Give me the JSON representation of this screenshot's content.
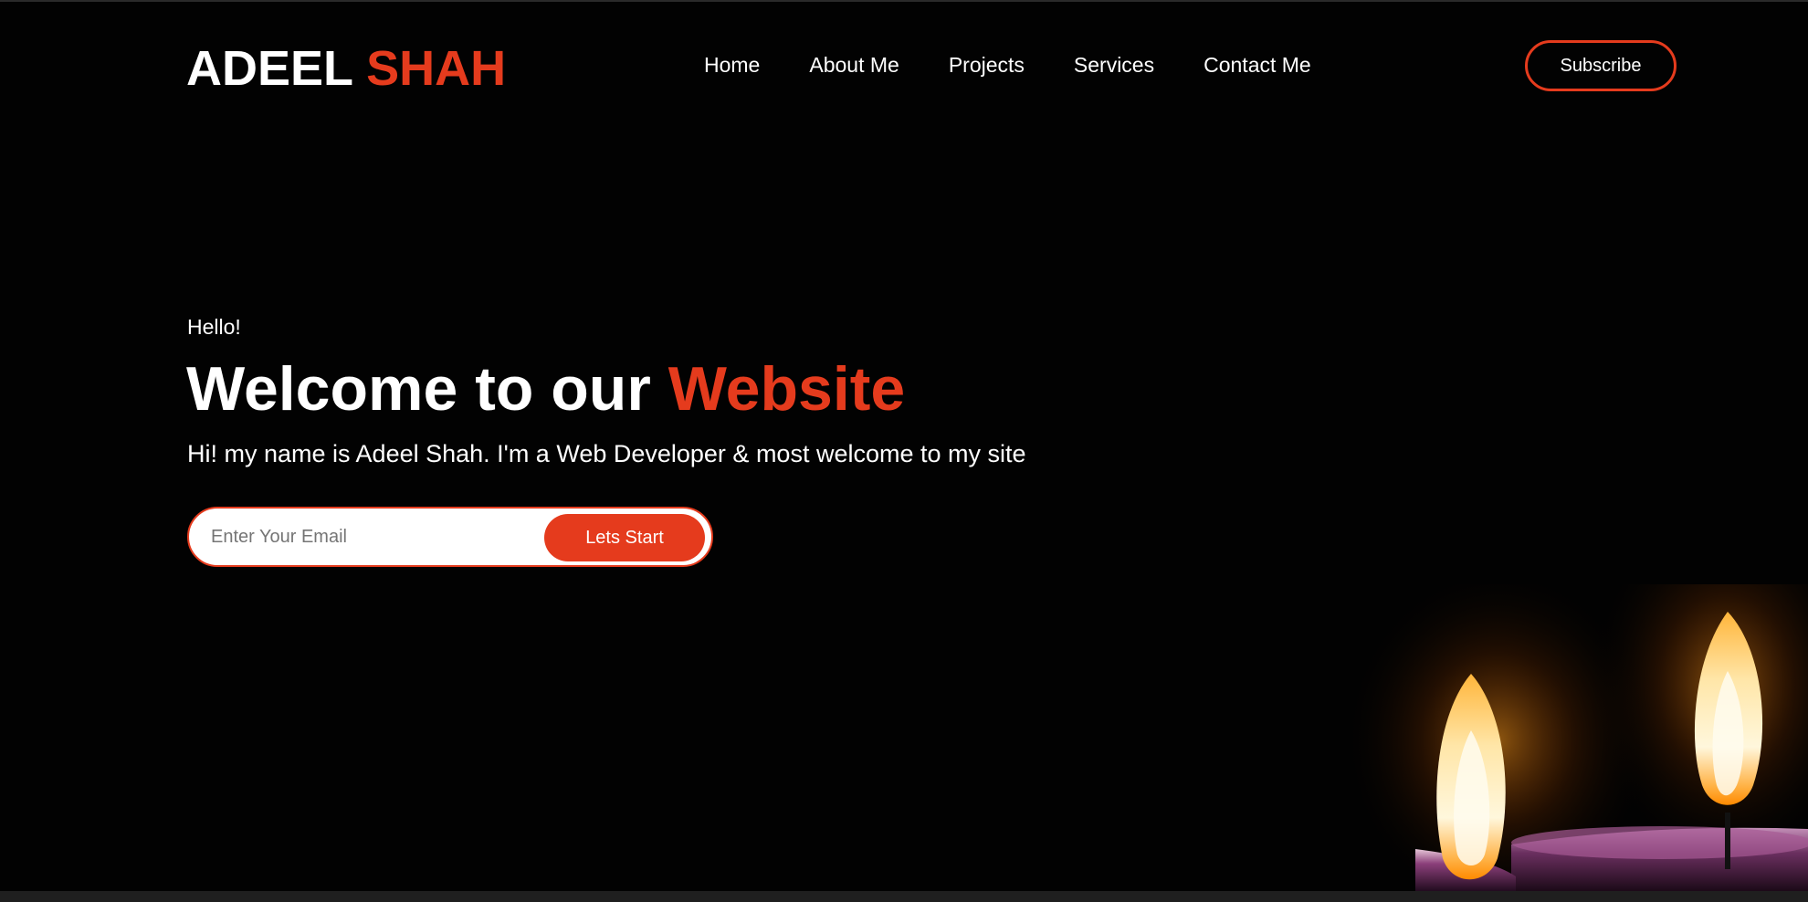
{
  "header": {
    "logo_first": "ADEEL",
    "logo_accent": "SHAH",
    "nav": [
      "Home",
      "About Me",
      "Projects",
      "Services",
      "Contact Me"
    ],
    "subscribe_label": "Subscribe"
  },
  "hero": {
    "greeting": "Hello!",
    "headline_main": "Welcome to our",
    "headline_accent": "Website",
    "tagline": "Hi! my name is Adeel Shah. I'm a Web Developer & most welcome to my site",
    "email_placeholder": "Enter Your Email",
    "cta_label": "Lets Start"
  },
  "colors": {
    "accent": "#e53b1d",
    "background": "#020202",
    "text": "#ffffff"
  },
  "background_image": "candles-image"
}
